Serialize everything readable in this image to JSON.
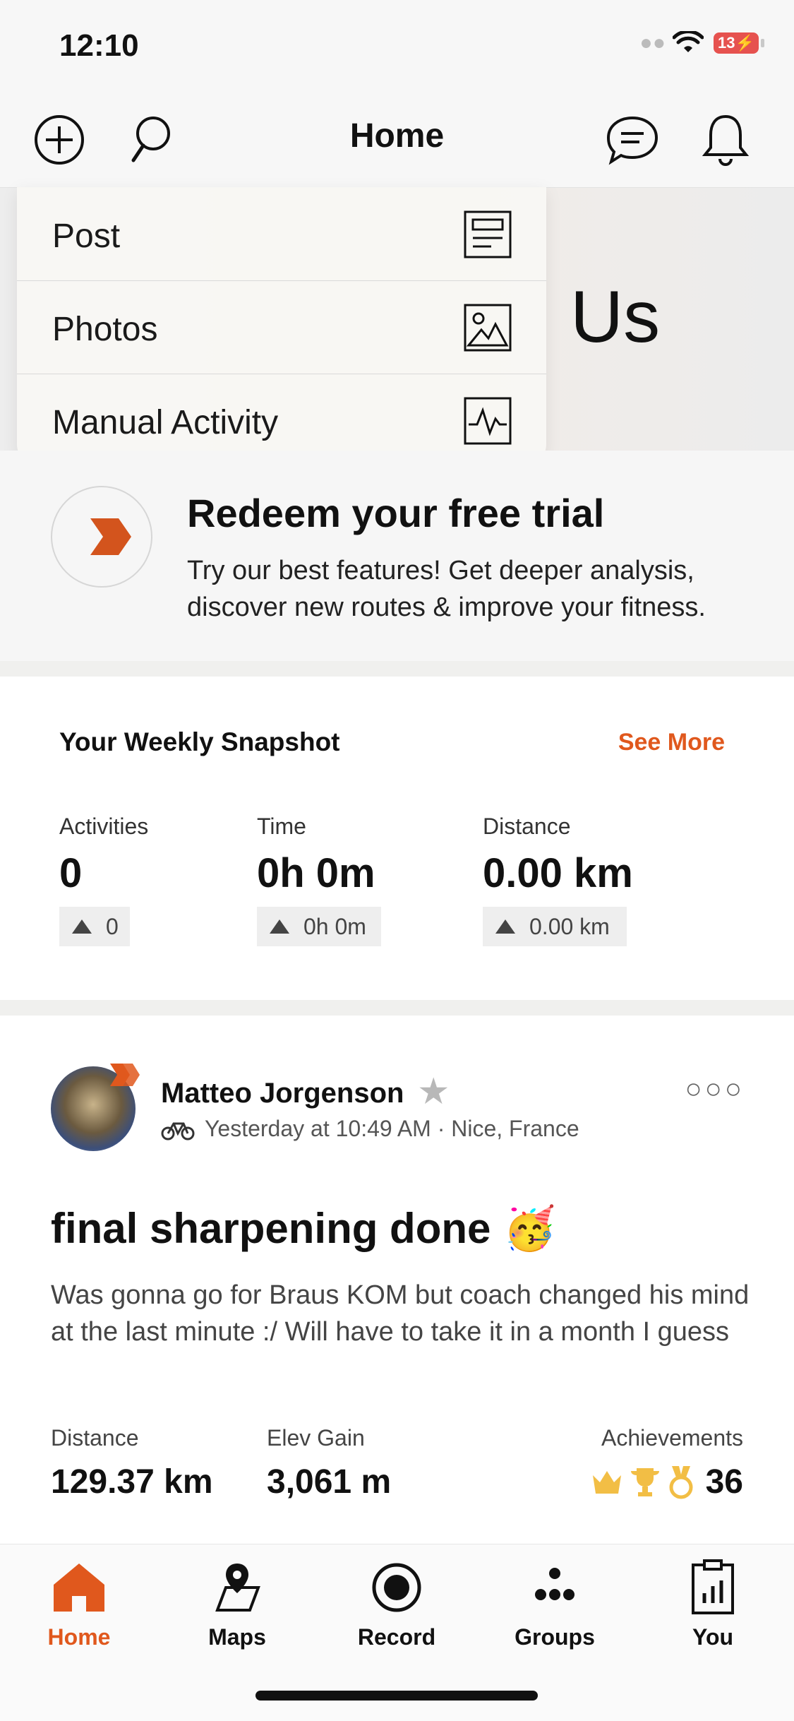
{
  "status_bar": {
    "time": "12:10",
    "battery": "13"
  },
  "header": {
    "title": "Home"
  },
  "background_partial_text": "Us",
  "create_menu": {
    "items": [
      {
        "label": "Post",
        "icon": "post-icon"
      },
      {
        "label": "Photos",
        "icon": "photos-icon"
      },
      {
        "label": "Manual Activity",
        "icon": "manual-activity-icon"
      }
    ]
  },
  "promo": {
    "title": "Redeem your free trial",
    "description": "Try our best features! Get deeper analysis, discover new routes & improve your fitness.",
    "badge_icon": "strava-chevron-icon"
  },
  "weekly_snapshot": {
    "title": "Your Weekly Snapshot",
    "see_more": "See More",
    "stats": [
      {
        "label": "Activities",
        "value": "0",
        "change": "0"
      },
      {
        "label": "Time",
        "value": "0h 0m",
        "change": "0h 0m"
      },
      {
        "label": "Distance",
        "value": "0.00 km",
        "change": "0.00 km"
      }
    ]
  },
  "feed_item": {
    "athlete_name": "Matteo Jorgenson",
    "meta": "Yesterday at 10:49 AM · Nice, France",
    "title": "final sharpening done",
    "title_emoji": "🥳",
    "description": "Was gonna go for Braus KOM but coach changed his mind at the last minute :/ Will have to take it in a month I guess",
    "metrics": {
      "distance_label": "Distance",
      "distance_value": "129.37 km",
      "elev_label": "Elev Gain",
      "elev_value": "3,061 m",
      "achievements_label": "Achievements",
      "achievements_value": "36"
    }
  },
  "tab_bar": {
    "tabs": [
      {
        "label": "Home",
        "active": true
      },
      {
        "label": "Maps",
        "active": false
      },
      {
        "label": "Record",
        "active": false
      },
      {
        "label": "Groups",
        "active": false
      },
      {
        "label": "You",
        "active": false
      }
    ]
  },
  "colors": {
    "accent": "#E0581D",
    "gold": "#F2BE45"
  }
}
